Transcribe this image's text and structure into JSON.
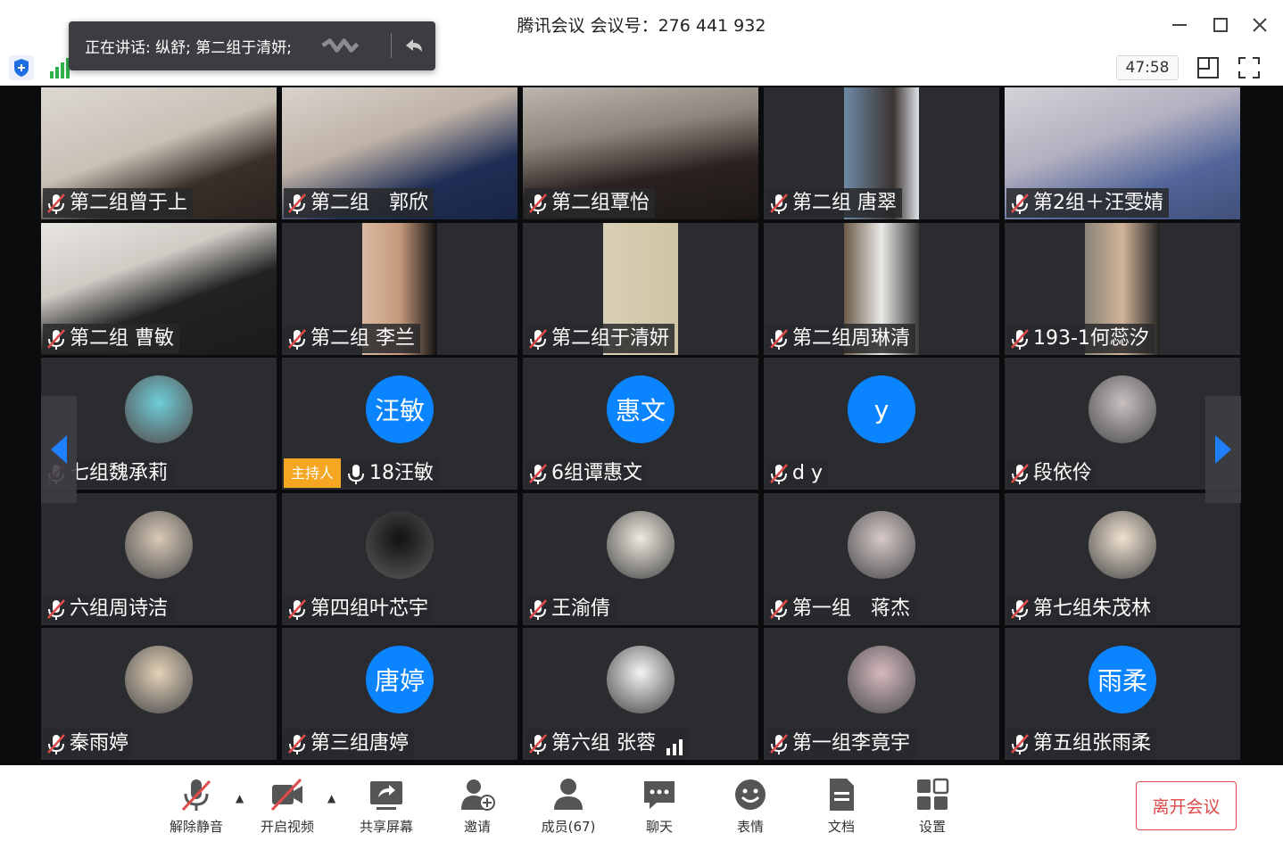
{
  "window": {
    "title": "腾讯会议 会议号：276 441 932"
  },
  "speaking": {
    "text": "正在讲话: 纵舒; 第二组于清妍;"
  },
  "meeting": {
    "timer": "47:58"
  },
  "tiles": [
    {
      "name": "第二组曾于上",
      "kind": "video"
    },
    {
      "name": "第二组　郭欣",
      "kind": "video"
    },
    {
      "name": "第二组覃怡",
      "kind": "video"
    },
    {
      "name": "第二组 唐翠",
      "kind": "video"
    },
    {
      "name": "第2组＋汪雯婧",
      "kind": "video"
    },
    {
      "name": "第二组 曹敏",
      "kind": "video"
    },
    {
      "name": "第二组 李兰",
      "kind": "video"
    },
    {
      "name": "第二组于清妍",
      "kind": "video"
    },
    {
      "name": "第二组周琳清",
      "kind": "video"
    },
    {
      "name": "193-1何蕊汐",
      "kind": "video"
    },
    {
      "name": "七组魏承莉",
      "kind": "photo"
    },
    {
      "name": "18汪敏",
      "kind": "initials",
      "initials": "汪敏",
      "host_badge": "主持人"
    },
    {
      "name": "6组谭惠文",
      "kind": "initials",
      "initials": "惠文"
    },
    {
      "name": "d y",
      "kind": "initials",
      "initials": "y"
    },
    {
      "name": "段依伶",
      "kind": "photo"
    },
    {
      "name": "六组周诗洁",
      "kind": "photo"
    },
    {
      "name": "第四组叶芯宇",
      "kind": "photo"
    },
    {
      "name": "王渝倩",
      "kind": "photo"
    },
    {
      "name": "第一组　蒋杰",
      "kind": "photo"
    },
    {
      "name": "第七组朱茂林",
      "kind": "photo"
    },
    {
      "name": "秦雨婷",
      "kind": "photo"
    },
    {
      "name": "第三组唐婷",
      "kind": "initials",
      "initials": "唐婷"
    },
    {
      "name": "第六组 张蓉",
      "kind": "photo"
    },
    {
      "name": "第一组李竟宇",
      "kind": "photo"
    },
    {
      "name": "第五组张雨柔",
      "kind": "initials",
      "initials": "雨柔"
    }
  ],
  "toolbar": {
    "unmute": "解除静音",
    "start_video": "开启视频",
    "share_screen": "共享屏幕",
    "invite": "邀请",
    "members": "成员(67)",
    "chat": "聊天",
    "reactions": "表情",
    "docs": "文档",
    "settings": "设置",
    "leave": "离开会议"
  },
  "colors": {
    "accent_blue": "#0a84ff",
    "host_badge": "#f5a623",
    "leave_red": "#e04a4a"
  }
}
